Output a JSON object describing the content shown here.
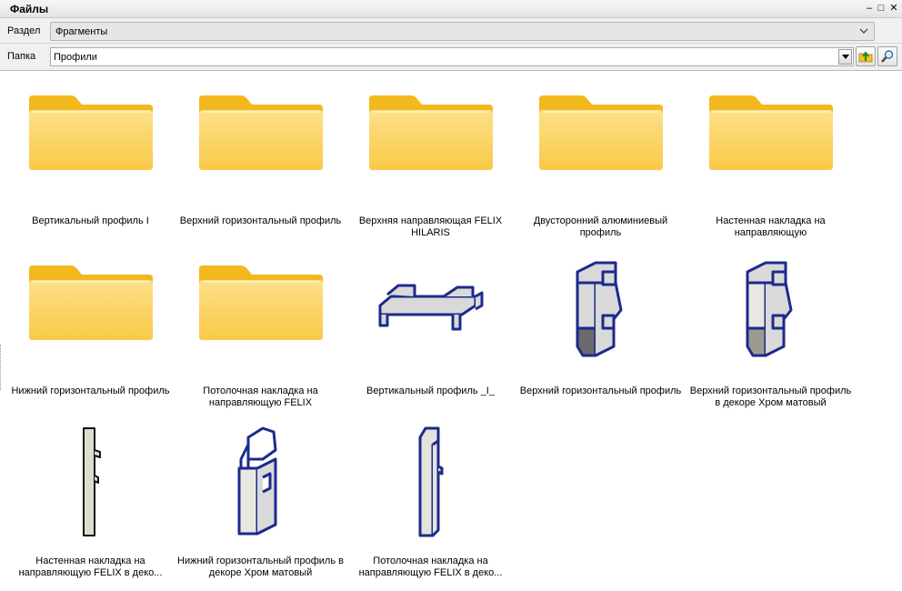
{
  "window": {
    "title": "Файлы",
    "minimize_glyph": "–",
    "restore_glyph": "□",
    "close_glyph": "✕"
  },
  "section": {
    "label": "Раздел",
    "value": "Фрагменты"
  },
  "folder": {
    "label": "Папка",
    "value": "Профили"
  },
  "toolbar": {
    "up_icon": "folder-up-icon",
    "search_icon": "search-icon"
  },
  "items": [
    {
      "caption": "Вертикальный профиль I",
      "kind": "folder"
    },
    {
      "caption": "Верхний горизонтальный профиль",
      "kind": "folder"
    },
    {
      "caption": "Верхняя направляющая FELIX HILARIS",
      "kind": "folder"
    },
    {
      "caption": "Двусторонний алюминиевый профиль",
      "kind": "folder"
    },
    {
      "caption": "Настенная накладка на направляющую",
      "kind": "folder"
    },
    {
      "caption": "Нижний горизонтальный профиль",
      "kind": "folder"
    },
    {
      "caption": "Потолочная накладка на направляющую FELIX",
      "kind": "folder"
    },
    {
      "caption": "Вертикальный профиль _I_",
      "kind": "model"
    },
    {
      "caption": "Верхний горизонтальный профиль",
      "kind": "model"
    },
    {
      "caption": "Верхний горизонтальный профиль в декоре Хром матовый",
      "kind": "model"
    },
    {
      "caption": "Настенная накладка на направляющую FELIX в деко...",
      "kind": "model"
    },
    {
      "caption": "Нижний горизонтальный профиль в декоре Хром матовый",
      "kind": "model"
    },
    {
      "caption": "Потолочная накладка на направляющую FELIX в деко...",
      "kind": "model"
    }
  ],
  "colors": {
    "folder_back": "#f2b81d",
    "folder_front": "#fcd46a",
    "model_stroke": "#1c2a8c",
    "model_fill": "#d9d9d9"
  }
}
